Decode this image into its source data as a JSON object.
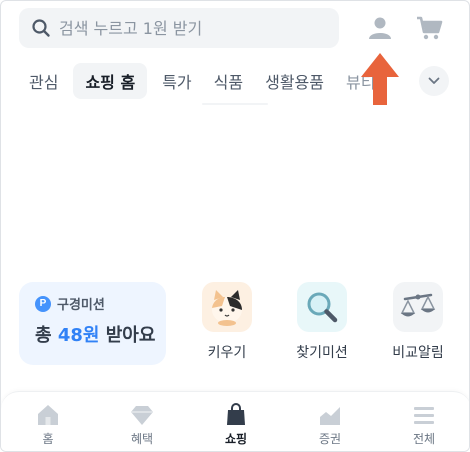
{
  "header": {
    "search_placeholder": "검색 누르고 1원 받기",
    "search_icon": "search-icon",
    "user_icon": "user-icon",
    "cart_icon": "cart-icon"
  },
  "tabs": [
    {
      "label": "관심",
      "active": false
    },
    {
      "label": "쇼핑 홈",
      "active": true
    },
    {
      "label": "특가",
      "active": false
    },
    {
      "label": "식품",
      "active": false
    },
    {
      "label": "생활용품",
      "active": false
    },
    {
      "label": "뷰티",
      "active": false
    }
  ],
  "mission": {
    "badge": "P",
    "label": "구경미션",
    "prefix": "총 ",
    "amount": "48원",
    "suffix": " 받아요"
  },
  "shortcuts": [
    {
      "label": "키우기",
      "icon": "cat-icon"
    },
    {
      "label": "찾기미션",
      "icon": "magnifier-icon"
    },
    {
      "label": "비교알림",
      "icon": "scale-icon"
    }
  ],
  "bottom_nav": [
    {
      "label": "홈",
      "icon": "home-icon",
      "active": false
    },
    {
      "label": "혜택",
      "icon": "gem-icon",
      "active": false
    },
    {
      "label": "쇼핑",
      "icon": "shopping-bag-icon",
      "active": true
    },
    {
      "label": "증권",
      "icon": "stock-chart-icon",
      "active": false
    },
    {
      "label": "전체",
      "icon": "menu-icon",
      "active": false
    }
  ],
  "colors": {
    "accent": "#3182f6",
    "arrow": "#e8643c",
    "search_bg": "#f2f4f6",
    "mission_bg": "#eef5ff"
  }
}
